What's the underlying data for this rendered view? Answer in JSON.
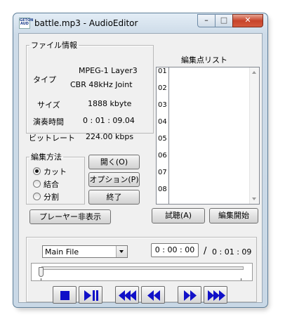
{
  "window": {
    "title": "battle.mp3 - AudioEditor",
    "icon_text": "GETON AUD"
  },
  "controls": {
    "minimize": "–",
    "maximize": "□",
    "close": "✕"
  },
  "file_info": {
    "legend": "ファイル情報",
    "type_label": "タイプ",
    "type_line1": "MPEG-1 Layer3",
    "type_line2": "CBR 48kHz Joint",
    "size_label": "サイズ",
    "size_value": "1888 kbyte",
    "duration_label": "演奏時間",
    "duration_value": "0 : 01 : 09.04",
    "bitrate_label": "ビットレート",
    "bitrate_value": "224.00 kbps"
  },
  "edit_mode": {
    "legend": "編集方法",
    "options": [
      {
        "label": "カット",
        "selected": true
      },
      {
        "label": "結合",
        "selected": false
      },
      {
        "label": "分割",
        "selected": false
      }
    ]
  },
  "buttons": {
    "open": "開く(O)",
    "options": "オプション(P)",
    "exit": "終了",
    "hide_player": "プレーヤー非表示",
    "audition": "試聴(A)",
    "start_edit": "編集開始"
  },
  "edit_points": {
    "title": "編集点リスト",
    "rows": [
      "01",
      "02",
      "03",
      "04",
      "05",
      "06",
      "07",
      "08"
    ]
  },
  "player": {
    "source_selected": "Main File",
    "current_time": "0 : 00 : 00",
    "separator": "/",
    "total_time": "0 : 01 : 09",
    "position": 0
  },
  "transport": [
    "stop-icon",
    "play-pause-icon",
    "fast-rewind-icon",
    "rewind-icon",
    "forward-icon",
    "fast-forward-icon"
  ],
  "colors": {
    "transport_blue": "#1010c8",
    "close_red": "#c7442b"
  }
}
